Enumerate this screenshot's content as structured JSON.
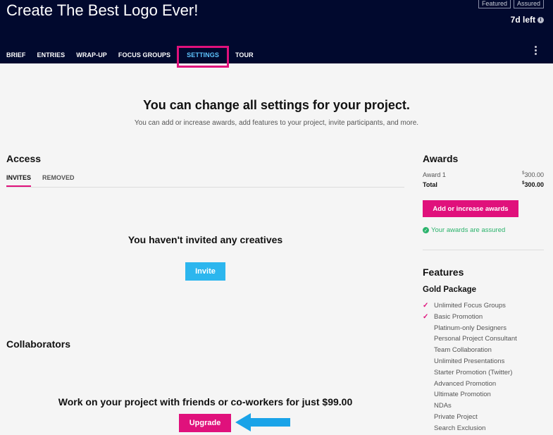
{
  "header": {
    "title": "Create The Best Logo Ever!",
    "badges": [
      "Featured",
      "Assured"
    ],
    "days_left": "7d left",
    "nav": [
      "BRIEF",
      "ENTRIES",
      "WRAP-UP",
      "FOCUS GROUPS",
      "SETTINGS",
      "TOUR"
    ],
    "active_tab": "SETTINGS"
  },
  "hero": {
    "title": "You can change all settings for your project.",
    "subtitle": "You can add or increase awards, add features to your project, invite participants, and more."
  },
  "access": {
    "title": "Access",
    "tabs": [
      "INVITES",
      "REMOVED"
    ],
    "empty_title": "You haven't invited any creatives",
    "invite_label": "Invite"
  },
  "collaborators": {
    "title": "Collaborators",
    "upgrade_text": "Work on your project with friends or co-workers for just $99.00",
    "upgrade_label": "Upgrade"
  },
  "awards": {
    "title": "Awards",
    "award1_label": "Award 1",
    "award1_currency": "$",
    "award1_value": "300.00",
    "total_label": "Total",
    "total_currency": "$",
    "total_value": "300.00",
    "button_label": "Add or increase awards",
    "assured_text": "Your awards are assured"
  },
  "features": {
    "title": "Features",
    "package": "Gold Package",
    "items": [
      {
        "label": "Unlimited Focus Groups",
        "checked": true
      },
      {
        "label": "Basic Promotion",
        "checked": true
      },
      {
        "label": "Platinum-only Designers",
        "checked": false
      },
      {
        "label": "Personal Project Consultant",
        "checked": false
      },
      {
        "label": "Team Collaboration",
        "checked": false
      },
      {
        "label": "Unlimited Presentations",
        "checked": false
      },
      {
        "label": "Starter Promotion (Twitter)",
        "checked": false
      },
      {
        "label": "Advanced Promotion",
        "checked": false
      },
      {
        "label": "Ultimate Promotion",
        "checked": false
      },
      {
        "label": "NDAs",
        "checked": false
      },
      {
        "label": "Private Project",
        "checked": false
      },
      {
        "label": "Search Exclusion",
        "checked": false
      }
    ]
  },
  "colors": {
    "header_bg": "#01092e",
    "accent_pink": "#e0117c",
    "invite_blue": "#2cb6ee",
    "success_green": "#2bb36c",
    "arrow_blue": "#1aa3e8"
  },
  "icons": {
    "info": "info-icon",
    "more": "kebab-menu-icon",
    "check": "checkmark-icon",
    "assured": "check-circle-icon",
    "arrow": "left-arrow-icon"
  }
}
